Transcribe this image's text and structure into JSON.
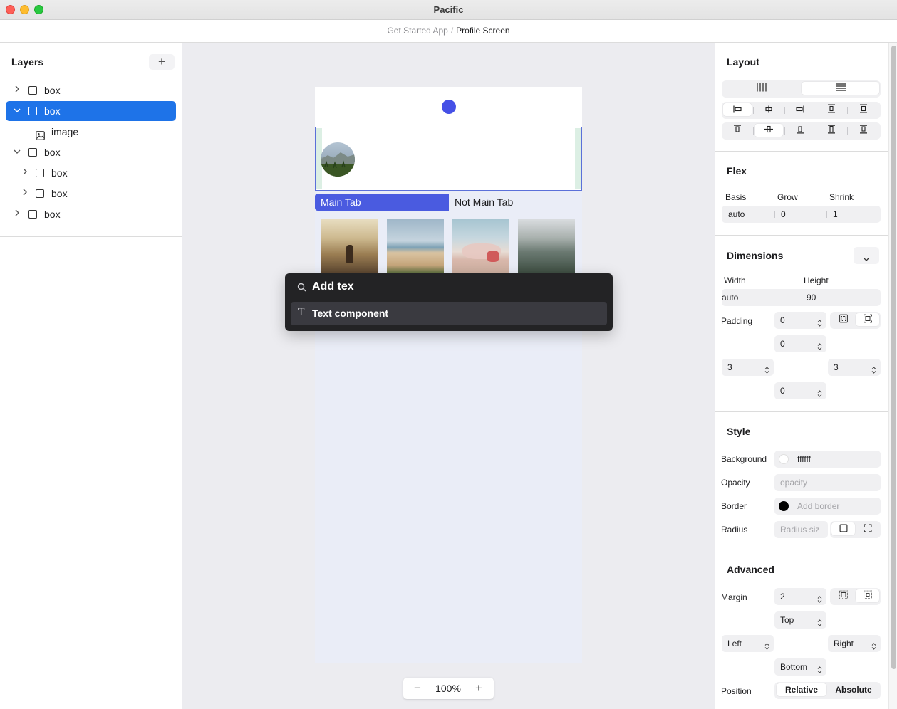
{
  "window": {
    "title": "Pacific"
  },
  "breadcrumb": {
    "project": "Get Started App",
    "separator": "/",
    "screen": "Profile Screen"
  },
  "layers": {
    "title": "Layers",
    "add_label": "+",
    "items": [
      {
        "label": "box",
        "expanded": false,
        "selected": false,
        "kind": "box"
      },
      {
        "label": "box",
        "expanded": true,
        "selected": true,
        "kind": "box"
      },
      {
        "label": "image",
        "kind": "image"
      },
      {
        "label": "box",
        "expanded": true,
        "selected": false,
        "kind": "box"
      },
      {
        "label": "box",
        "expanded": false,
        "selected": false,
        "kind": "box"
      },
      {
        "label": "box",
        "expanded": false,
        "selected": false,
        "kind": "box"
      },
      {
        "label": "box",
        "expanded": false,
        "selected": false,
        "kind": "box"
      }
    ]
  },
  "canvas": {
    "tabs": {
      "main": "Main Tab",
      "other": "Not Main Tab"
    },
    "zoom": {
      "minus": "−",
      "value": "100%",
      "plus": "+"
    },
    "accent_color": "#4a5be0"
  },
  "palette": {
    "query": "Add tex",
    "result_label": "Text component",
    "result_icon": "T"
  },
  "inspector": {
    "layout": {
      "title": "Layout"
    },
    "flex": {
      "title": "Flex",
      "basis_label": "Basis",
      "grow_label": "Grow",
      "shrink_label": "Shrink",
      "basis": "auto",
      "grow": "0",
      "shrink": "1"
    },
    "dimensions": {
      "title": "Dimensions",
      "width_label": "Width",
      "height_label": "Height",
      "width": "auto",
      "height": "90",
      "padding_label": "Padding",
      "padding_top": "0",
      "padding_inner": "0",
      "padding_left": "3",
      "padding_right": "3",
      "padding_bottom": "0"
    },
    "style": {
      "title": "Style",
      "background_label": "Background",
      "background": "ffffff",
      "opacity_label": "Opacity",
      "opacity_placeholder": "opacity",
      "border_label": "Border",
      "border_placeholder": "Add border",
      "radius_label": "Radius",
      "radius_placeholder": "Radius siz"
    },
    "advanced": {
      "title": "Advanced",
      "margin_label": "Margin",
      "margin": "2",
      "top": "Top",
      "left": "Left",
      "right": "Right",
      "bottom": "Bottom",
      "position_label": "Position",
      "relative": "Relative",
      "absolute": "Absolute"
    }
  },
  "colors": {
    "selection": "#1e73e8",
    "title_bar": "#e3e3e3"
  }
}
